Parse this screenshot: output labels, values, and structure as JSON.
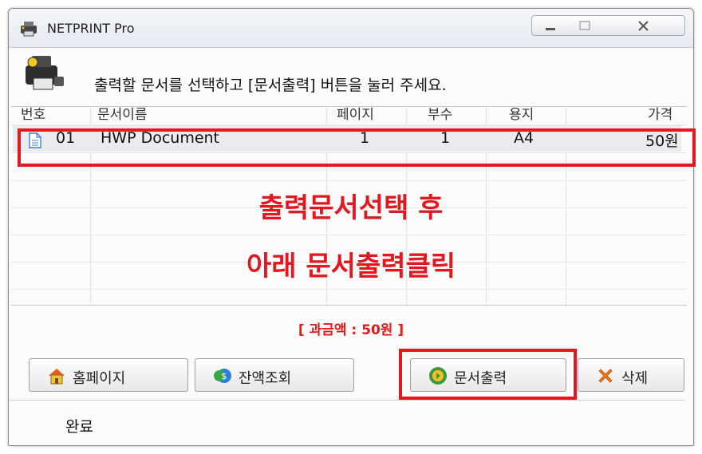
{
  "window": {
    "title": "NETPRINT Pro"
  },
  "header": {
    "instruction": "출력할 문서를 선택하고 [문서출력] 버튼을 눌러 주세요."
  },
  "table": {
    "columns": [
      "번호",
      "문서이름",
      "페이지",
      "부수",
      "용지",
      "가격"
    ],
    "rows": [
      {
        "number": "01",
        "name": "HWP Document",
        "pages": "1",
        "copies": "1",
        "paper": "A4",
        "price": "50원"
      }
    ]
  },
  "overlay": {
    "line1": "출력문서선택 후",
    "line2": "아래 문서출력클릭"
  },
  "charge": "[ 과금액 : 50원 ]",
  "buttons": {
    "home": "홈페이지",
    "balance": "잔액조회",
    "print": "문서출력",
    "delete": "삭제"
  },
  "status": "완료",
  "colors": {
    "highlight": "#e4161f"
  }
}
